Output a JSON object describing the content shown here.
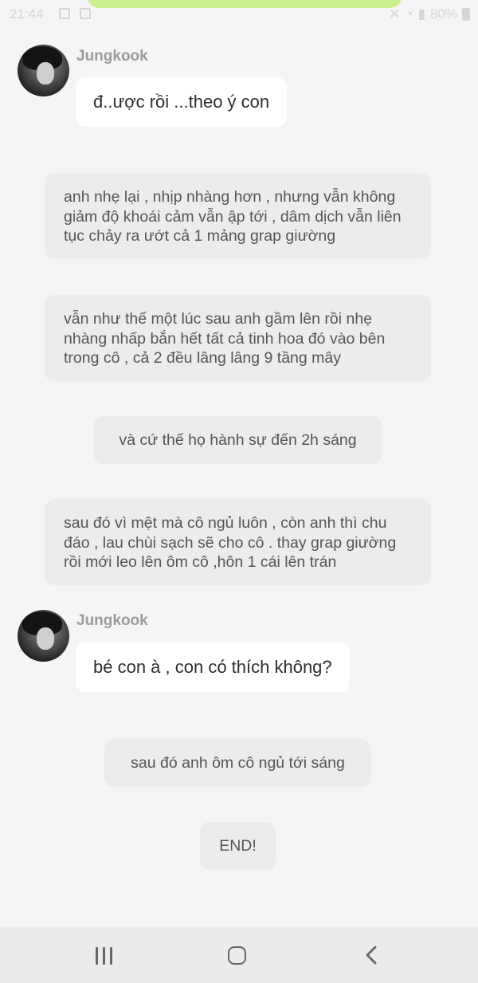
{
  "status": {
    "time": "21:44",
    "battery": "80%"
  },
  "messages": [
    {
      "type": "character",
      "sender": "Jungkook",
      "text": "đ..ược rồi ...theo ý con"
    },
    {
      "type": "narration",
      "text": "anh nhẹ lại , nhịp nhàng hơn , nhưng vẫn không giảm độ khoái cảm vẫn ập tới , dâm dịch vẫn liên tục chảy ra ướt cả 1 mảng grap giường"
    },
    {
      "type": "narration",
      "text": "vẫn như thế một lúc sau anh gầm lên rồi nhẹ nhàng nhấp bắn hết tất cả tinh hoa đó vào bên trong cô , cả 2 đều lâng lâng 9 tầng mây"
    },
    {
      "type": "narration",
      "text": "và cứ thế họ hành sự đến 2h sáng"
    },
    {
      "type": "narration",
      "text": "sau đó vì mệt mà cô ngủ luôn , còn anh thì chu đáo , lau chùi sạch sẽ cho cô . thay grap giường rồi mới leo lên ôm cô ,hôn 1 cái lên trán"
    },
    {
      "type": "character",
      "sender": "Jungkook",
      "text": "bé con à , con có thích không?"
    },
    {
      "type": "narration",
      "text": "sau đó anh ôm cô ngủ tới sáng"
    },
    {
      "type": "narration",
      "text": "END!"
    }
  ],
  "nav": {
    "recent_icon": "recent-apps-icon",
    "home_icon": "home-icon",
    "back_icon": "back-icon"
  },
  "colors": {
    "background": "#f5f5f5",
    "narration_bubble": "#ececec",
    "character_bubble": "#ffffff",
    "sender_name": "#9b9b9b",
    "top_pill": "#c9ef8e"
  }
}
